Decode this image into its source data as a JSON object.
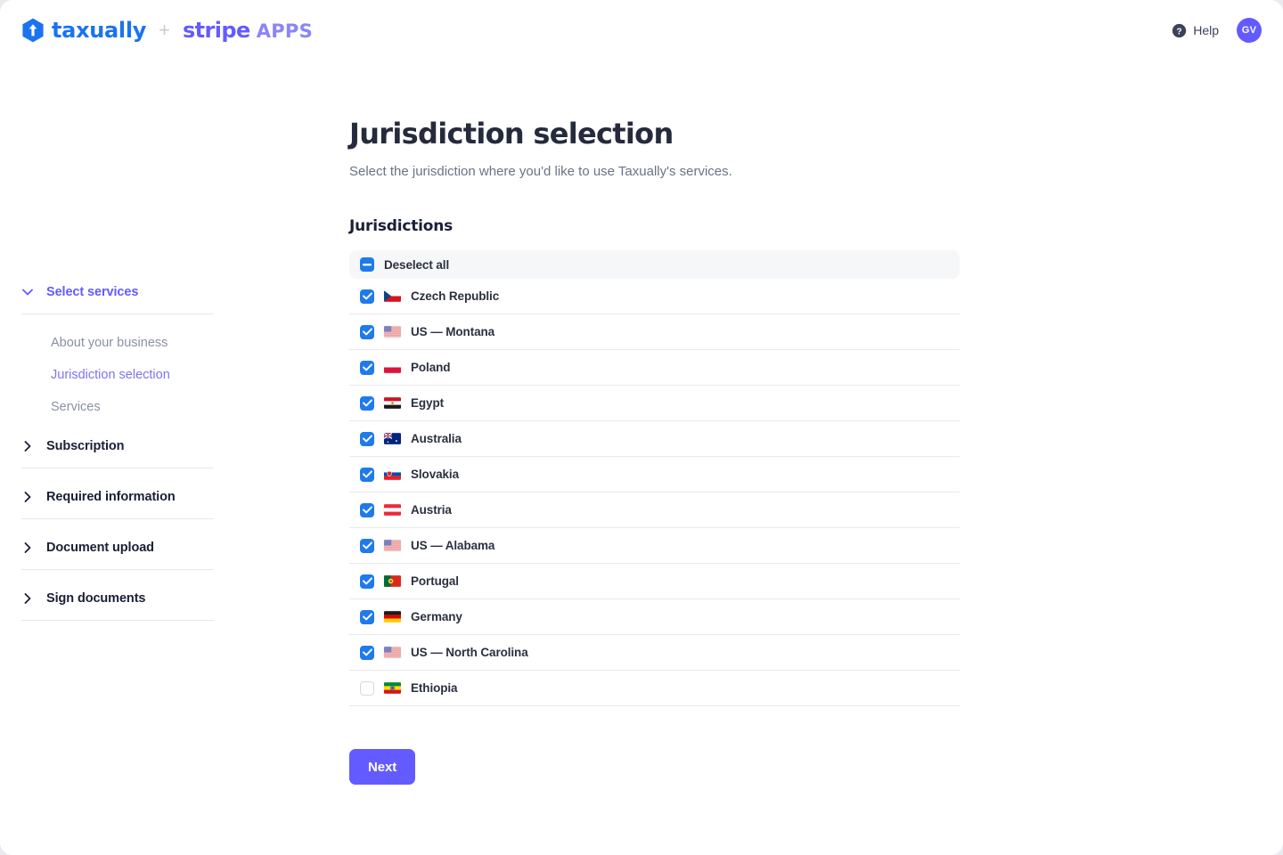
{
  "header": {
    "brand_taxually": "taxually",
    "brand_plus": "+",
    "brand_stripe": "stripe",
    "brand_apps": "APPS",
    "help_label": "Help",
    "avatar_initials": "GV"
  },
  "sidebar": {
    "sections": [
      {
        "label": "Select services",
        "expanded": true,
        "active": true,
        "items": [
          {
            "label": "About your business",
            "current": false
          },
          {
            "label": "Jurisdiction selection",
            "current": true
          },
          {
            "label": "Services",
            "current": false
          }
        ]
      },
      {
        "label": "Subscription",
        "expanded": false,
        "active": false,
        "items": []
      },
      {
        "label": "Required information",
        "expanded": false,
        "active": false,
        "items": []
      },
      {
        "label": "Document upload",
        "expanded": false,
        "active": false,
        "items": []
      },
      {
        "label": "Sign documents",
        "expanded": false,
        "active": false,
        "items": []
      }
    ]
  },
  "main": {
    "title": "Jurisdiction selection",
    "subtitle": "Select the jurisdiction where you'd like to use Taxually's services.",
    "section_title": "Jurisdictions",
    "deselect_all_label": "Deselect all",
    "deselect_all_state": "indeterminate",
    "next_label": "Next",
    "jurisdictions": [
      {
        "label": "Czech Republic",
        "checked": true,
        "flag": "cz"
      },
      {
        "label": "US — Montana",
        "checked": true,
        "flag": "us"
      },
      {
        "label": "Poland",
        "checked": true,
        "flag": "pl"
      },
      {
        "label": "Egypt",
        "checked": true,
        "flag": "eg"
      },
      {
        "label": "Australia",
        "checked": true,
        "flag": "au"
      },
      {
        "label": "Slovakia",
        "checked": true,
        "flag": "sk"
      },
      {
        "label": "Austria",
        "checked": true,
        "flag": "at"
      },
      {
        "label": "US — Alabama",
        "checked": true,
        "flag": "us"
      },
      {
        "label": "Portugal",
        "checked": true,
        "flag": "pt"
      },
      {
        "label": "Germany",
        "checked": true,
        "flag": "de"
      },
      {
        "label": "US — North Carolina",
        "checked": true,
        "flag": "us"
      },
      {
        "label": "Ethiopia",
        "checked": false,
        "flag": "et"
      }
    ]
  },
  "colors": {
    "accent_purple": "#635bff",
    "taxually_blue": "#1a73f0",
    "checkbox_blue": "#1f7aec",
    "row_header_bg": "#f6f7f9",
    "border": "#e7eaee"
  }
}
